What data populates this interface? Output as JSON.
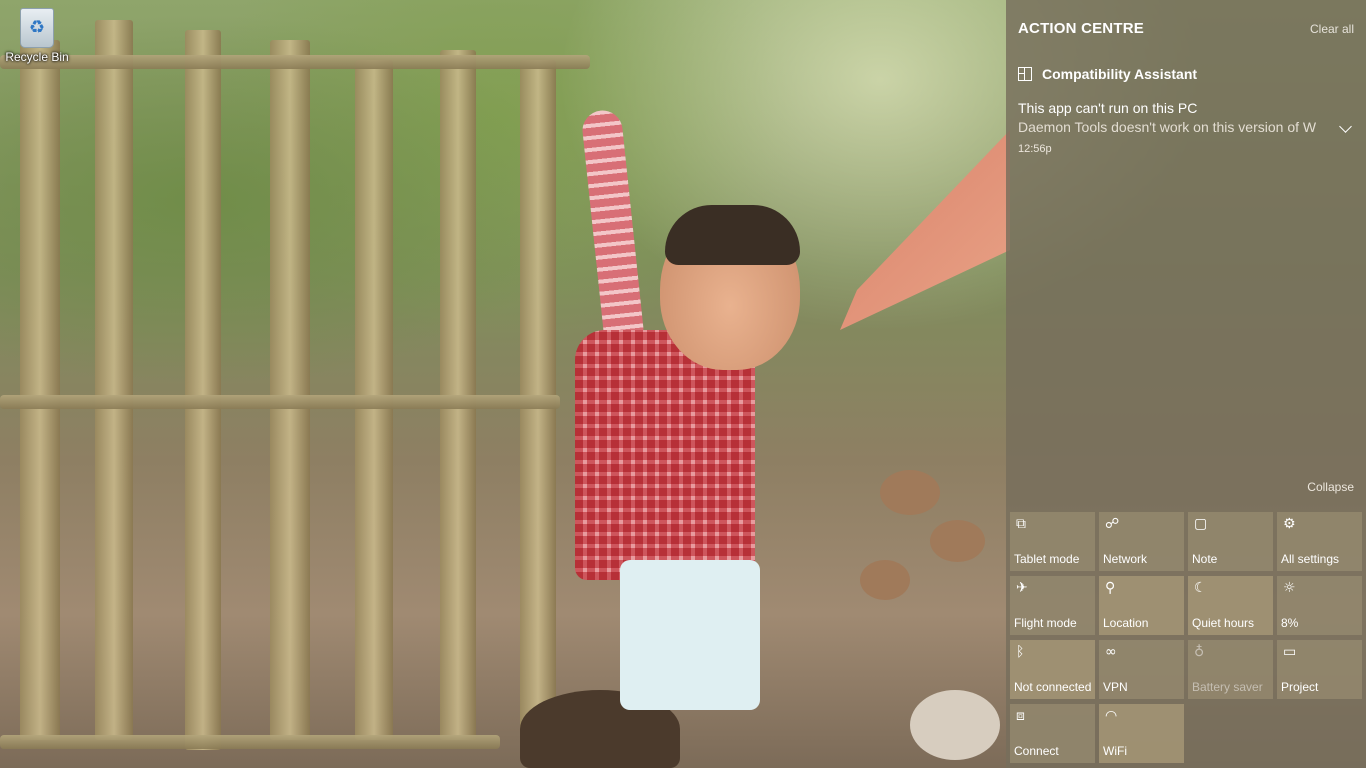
{
  "desktop": {
    "icons": [
      {
        "label": "Recycle Bin",
        "icon": "recycle-bin-icon"
      }
    ]
  },
  "action_centre": {
    "title": "ACTION CENTRE",
    "clear_all": "Clear all",
    "collapse": "Collapse",
    "notification_group": {
      "app_name": "Compatibility Assistant",
      "icon": "compatibility-assistant-icon",
      "notification": {
        "title": "This app can't run on this PC",
        "body": "Daemon Tools doesn't work on this version of W",
        "time": "12:56p"
      }
    },
    "quick_actions": [
      {
        "label": "Tablet mode",
        "icon": "tablet-mode-icon",
        "glyph": "⧉",
        "state": "normal"
      },
      {
        "label": "Network",
        "icon": "network-icon",
        "glyph": "☍",
        "state": "normal"
      },
      {
        "label": "Note",
        "icon": "note-icon",
        "glyph": "▢",
        "state": "normal"
      },
      {
        "label": "All settings",
        "icon": "settings-gear-icon",
        "glyph": "⚙",
        "state": "normal"
      },
      {
        "label": "Flight mode",
        "icon": "airplane-icon",
        "glyph": "✈",
        "state": "normal"
      },
      {
        "label": "Location",
        "icon": "location-icon",
        "glyph": "⚲",
        "state": "active"
      },
      {
        "label": "Quiet hours",
        "icon": "moon-icon",
        "glyph": "☾",
        "state": "active"
      },
      {
        "label": "8%",
        "icon": "brightness-icon",
        "glyph": "☼",
        "state": "normal"
      },
      {
        "label": "Not connected",
        "icon": "bluetooth-icon",
        "glyph": "ᛒ",
        "state": "active"
      },
      {
        "label": "VPN",
        "icon": "vpn-icon",
        "glyph": "∞",
        "state": "normal"
      },
      {
        "label": "Battery saver",
        "icon": "battery-saver-icon",
        "glyph": "♁",
        "state": "disabled"
      },
      {
        "label": "Project",
        "icon": "project-icon",
        "glyph": "▭",
        "state": "normal"
      },
      {
        "label": "Connect",
        "icon": "connect-icon",
        "glyph": "⧈",
        "state": "normal"
      },
      {
        "label": "WiFi",
        "icon": "wifi-icon",
        "glyph": "◠",
        "state": "active"
      }
    ]
  }
}
